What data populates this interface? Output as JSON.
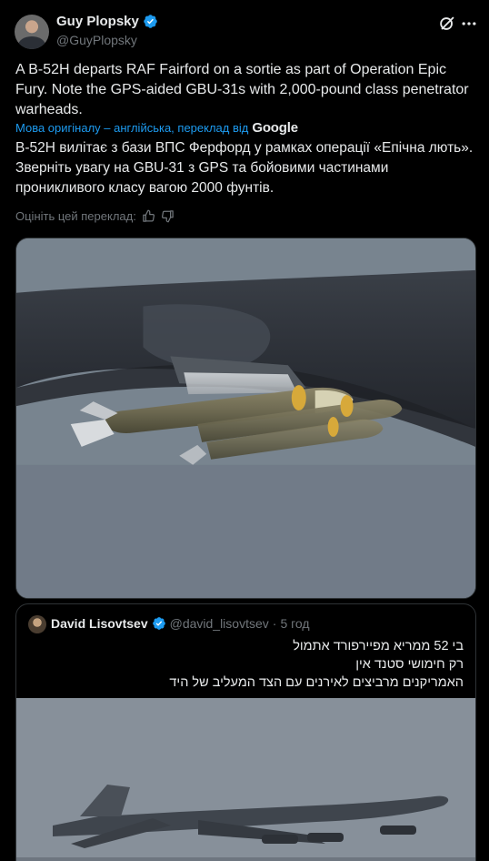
{
  "author": {
    "name": "Guy Plopsky",
    "handle": "@GuyPlopsky"
  },
  "icons": {
    "verified": "verified-badge-icon",
    "grok": "grok-icon",
    "more": "more-icon",
    "thumbs_up": "thumbs-up-icon",
    "thumbs_down": "thumbs-down-icon"
  },
  "colors": {
    "background": "#000000",
    "text": "#e7e9ea",
    "secondary_text": "#71767b",
    "link": "#1d9bf0",
    "border": "#2f3336",
    "verified": "#1d9bf0"
  },
  "tweet": {
    "text": "A B-52H departs RAF Fairford on a sortie as part of Operation Epic Fury. Note the GPS-aided GBU-31s with 2,000-pound class penetrator warheads.",
    "translation_label": "Мова оригіналу – англійська, переклад від",
    "translation_provider": "Google",
    "translated_text": "B-52H вилітає з бази ВПС Ферфорд у рамках операції «Епічна лють». Зверніть увагу на GBU-31 з GPS та бойовими частинами проникливого класу вагою 2000 фунтів.",
    "rate_translation": "Оцініть цей переклад:"
  },
  "quote": {
    "name": "David Lisovtsev",
    "handle": "@david_lisovtsev",
    "separator": "·",
    "time": "5 год",
    "lines": [
      "בי 52 ממריא מפיירפורד אתמול",
      "רק חימושי סטנד אין",
      "האמריקנים מרביצים לאירנים עם הצד המעליב של היד"
    ]
  }
}
